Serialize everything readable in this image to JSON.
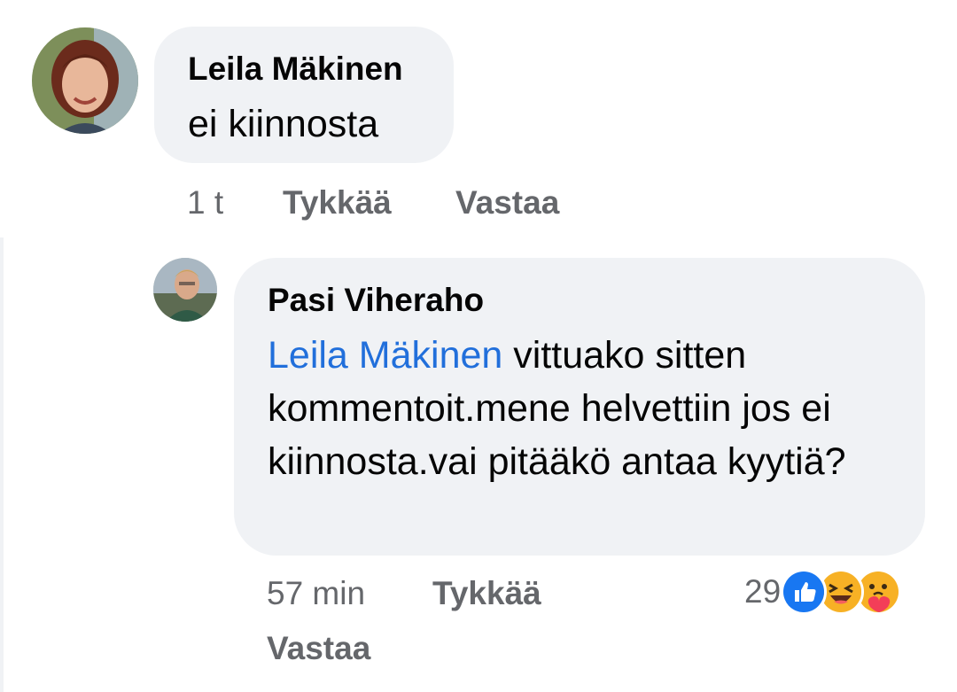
{
  "comments": [
    {
      "author": "Leila Mäkinen",
      "text": "ei kiinnosta",
      "time": "1 t",
      "like_label": "Tykkää",
      "reply_label": "Vastaa"
    },
    {
      "author": "Pasi Viheraho",
      "mention": "Leila Mäkinen",
      "text": " vittuako sitten kommentoit.mene helvettiin jos ei kiinnosta.vai pitääkö antaa kyytiä?",
      "time": "57 min",
      "like_label": "Tykkää",
      "reply_label": "Vastaa",
      "reactions": {
        "count": "29",
        "types": [
          "like-icon",
          "haha-icon",
          "care-icon"
        ]
      }
    }
  ],
  "colors": {
    "bubble": "#f0f2f5",
    "mention": "#216fdb",
    "meta": "#65676b",
    "like_blue": "#1877f2",
    "emoji_yellow": "#f7b125"
  }
}
